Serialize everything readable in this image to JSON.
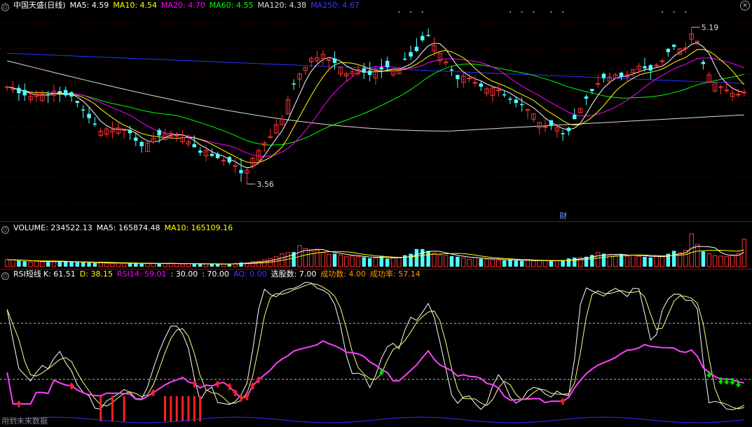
{
  "price_header": {
    "title": "中国天盛(日线)",
    "ma5": "MA5: 4.59",
    "ma10": "MA10: 4.54",
    "ma20": "MA20: 4.70",
    "ma60": "MA60: 4.55",
    "ma120": "MA120: 4.38",
    "ma250": "MA250: 4.67"
  },
  "price_annotations": {
    "high": "5.19",
    "low": "3.56",
    "event_marker": "财"
  },
  "volume_header": {
    "volume": "VOLUME: 234522.13",
    "ma5": "MA5: 165874.48",
    "ma10": "MA10: 165109.16"
  },
  "rsi_header": {
    "title": "RSI短线",
    "k": "K: 61.51",
    "d": "D: 38.15",
    "rsi14": "RSI14: 59.01",
    "low": ": 30.00",
    "high": ": 70.00",
    "aq": "AQ: 0.00",
    "selected": "选股数: 7.00",
    "success": "成功数: 4.00",
    "rate": "成功率: 57.14"
  },
  "footer": {
    "note": "用到未来数据"
  },
  "colors": {
    "ma5": "#ffffff",
    "ma10": "#ffff00",
    "ma20": "#ff00ff",
    "ma60": "#00ff00",
    "ma120": "#dcdcdc",
    "ma250": "#3030ff",
    "up": "#ff3232",
    "down": "#54ffff",
    "separator": "#a00000",
    "k_line": "#ffffff",
    "d_line": "#ffff80",
    "rsi_line": "#ff40ff",
    "buy_signal": "#ff2020",
    "sell_signal": "#00e000"
  },
  "chart_data": [
    {
      "type": "candlestick",
      "title": "中国天盛(日线)",
      "ylim": [
        3.5,
        5.3
      ],
      "high_label": 5.19,
      "low_label": 3.56,
      "series": [
        {
          "name": "MA5",
          "value": 4.59
        },
        {
          "name": "MA10",
          "value": 4.54
        },
        {
          "name": "MA20",
          "value": 4.7
        },
        {
          "name": "MA60",
          "value": 4.55
        },
        {
          "name": "MA120",
          "value": 4.38
        },
        {
          "name": "MA250",
          "value": 4.67
        }
      ],
      "close": [
        4.64,
        4.62,
        4.58,
        4.56,
        4.55,
        4.57,
        4.57,
        4.56,
        4.6,
        4.58,
        4.56,
        4.55,
        4.49,
        4.42,
        4.35,
        4.29,
        4.23,
        4.25,
        4.24,
        4.26,
        4.24,
        4.21,
        4.14,
        4.09,
        4.12,
        4.16,
        4.19,
        4.21,
        4.21,
        4.19,
        4.17,
        4.13,
        4.08,
        4.03,
        4.05,
        4.0,
        3.98,
        3.96,
        3.94,
        3.91,
        3.84,
        3.87,
        3.98,
        4.05,
        4.12,
        4.18,
        4.29,
        4.34,
        4.52,
        4.66,
        4.76,
        4.82,
        4.9,
        4.91,
        4.94,
        4.89,
        4.86,
        4.82,
        4.76,
        4.78,
        4.8,
        4.77,
        4.75,
        4.8,
        4.8,
        4.82,
        4.79,
        4.8,
        4.89,
        4.92,
        4.97,
        5.07,
        5.11,
        5.02,
        4.95,
        4.87,
        4.79,
        4.71,
        4.74,
        4.72,
        4.68,
        4.64,
        4.62,
        4.63,
        4.61,
        4.56,
        4.52,
        4.49,
        4.47,
        4.43,
        4.39,
        4.31,
        4.27,
        4.28,
        4.26,
        4.2,
        4.23,
        4.34,
        4.44,
        4.53,
        4.6,
        4.67,
        4.72,
        4.73,
        4.75,
        4.73,
        4.75,
        4.8,
        4.83,
        4.81,
        4.79,
        4.84,
        4.88,
        4.96,
        5.01,
        4.99,
        5.0,
        5.13,
        5.06,
        4.85,
        4.75,
        4.68,
        4.64,
        4.61,
        4.58,
        4.57,
        4.59
      ],
      "open": [
        4.64,
        4.62,
        4.63,
        4.61,
        4.52,
        4.55,
        4.51,
        4.57,
        4.56,
        4.6,
        4.61,
        4.59,
        4.51,
        4.43,
        4.39,
        4.3,
        4.19,
        4.2,
        4.22,
        4.21,
        4.24,
        4.24,
        4.17,
        4.13,
        4.04,
        4.13,
        4.24,
        4.15,
        4.18,
        4.19,
        4.13,
        4.11,
        4.11,
        4.05,
        4.0,
        4.02,
        4.02,
        3.96,
        3.99,
        3.91,
        3.87,
        3.84,
        3.91,
        3.96,
        4.1,
        4.17,
        4.21,
        4.29,
        4.39,
        4.67,
        4.71,
        4.79,
        4.87,
        4.88,
        4.9,
        4.89,
        4.9,
        4.76,
        4.74,
        4.76,
        4.76,
        4.81,
        4.79,
        4.72,
        4.82,
        4.88,
        4.75,
        4.76,
        4.9,
        4.96,
        5.01,
        5.11,
        5.12,
        4.97,
        4.88,
        4.86,
        4.8,
        4.75,
        4.68,
        4.72,
        4.68,
        4.67,
        4.58,
        4.56,
        4.61,
        4.57,
        4.53,
        4.52,
        4.48,
        4.42,
        4.34,
        4.26,
        4.27,
        4.33,
        4.23,
        4.21,
        4.26,
        4.38,
        4.4,
        4.55,
        4.62,
        4.67,
        4.76,
        4.69,
        4.72,
        4.77,
        4.73,
        4.77,
        4.8,
        4.83,
        4.84,
        4.84,
        4.88,
        4.99,
        5.03,
        4.94,
        5.0,
        5.08,
        5.05,
        4.87,
        4.68,
        4.6,
        4.64,
        4.61,
        4.55,
        4.57,
        4.59
      ],
      "high": [
        4.65,
        4.69,
        4.66,
        4.67,
        4.6,
        4.61,
        4.61,
        4.6,
        4.66,
        4.64,
        4.64,
        4.6,
        4.51,
        4.47,
        4.45,
        4.36,
        4.26,
        4.27,
        4.32,
        4.31,
        4.25,
        4.28,
        4.22,
        4.14,
        4.14,
        4.22,
        4.26,
        4.25,
        4.24,
        4.22,
        4.24,
        4.2,
        4.19,
        4.08,
        4.1,
        4.07,
        4.04,
        4.01,
        4.0,
        3.98,
        3.98,
        3.88,
        3.99,
        4.07,
        4.14,
        4.25,
        4.34,
        4.38,
        4.56,
        4.71,
        4.77,
        4.82,
        4.92,
        4.97,
        4.98,
        4.89,
        4.97,
        4.82,
        4.78,
        4.81,
        4.84,
        4.86,
        4.87,
        4.82,
        4.9,
        4.92,
        4.8,
        4.82,
        4.96,
        5.02,
        5.09,
        5.15,
        5.18,
        5.1,
        4.95,
        4.89,
        4.83,
        4.75,
        4.78,
        4.76,
        4.74,
        4.69,
        4.64,
        4.65,
        4.66,
        4.61,
        4.55,
        4.55,
        4.54,
        4.44,
        4.39,
        4.31,
        4.35,
        4.33,
        4.3,
        4.24,
        4.27,
        4.44,
        4.44,
        4.57,
        4.62,
        4.75,
        4.77,
        4.77,
        4.77,
        4.78,
        4.79,
        4.8,
        4.86,
        4.91,
        4.85,
        4.86,
        4.9,
        5.0,
        5.03,
        5.0,
        5.05,
        5.19,
        5.07,
        4.89,
        4.78,
        4.68,
        4.66,
        4.69,
        4.63,
        4.62,
        4.62
      ],
      "low": [
        4.6,
        4.58,
        4.51,
        4.51,
        4.49,
        4.5,
        4.5,
        4.49,
        4.5,
        4.5,
        4.54,
        4.5,
        4.45,
        4.35,
        4.3,
        4.27,
        4.17,
        4.17,
        4.16,
        4.19,
        4.16,
        4.15,
        4.09,
        4.03,
        4.04,
        4.11,
        4.12,
        4.15,
        4.17,
        4.13,
        4.11,
        4.08,
        4.08,
        4.0,
        3.95,
        3.99,
        3.97,
        3.91,
        3.92,
        3.84,
        3.76,
        3.74,
        3.88,
        3.92,
        4.04,
        4.16,
        4.21,
        4.29,
        4.38,
        4.61,
        4.63,
        4.75,
        4.82,
        4.84,
        4.84,
        4.78,
        4.8,
        4.73,
        4.69,
        4.73,
        4.74,
        4.71,
        4.69,
        4.66,
        4.72,
        4.79,
        4.73,
        4.76,
        4.88,
        4.89,
        4.96,
        5.05,
        5.1,
        4.92,
        4.84,
        4.83,
        4.74,
        4.63,
        4.63,
        4.68,
        4.64,
        4.6,
        4.55,
        4.5,
        4.55,
        4.54,
        4.48,
        4.45,
        4.41,
        4.34,
        4.31,
        4.2,
        4.22,
        4.24,
        4.17,
        4.14,
        4.19,
        4.35,
        4.39,
        4.47,
        4.57,
        4.63,
        4.68,
        4.66,
        4.71,
        4.7,
        4.68,
        4.73,
        4.76,
        4.78,
        4.71,
        4.82,
        4.82,
        4.92,
        4.98,
        4.93,
        4.95,
        5.04,
        5.02,
        4.8,
        4.68,
        4.59,
        4.57,
        4.58,
        4.51,
        4.54,
        4.55
      ]
    },
    {
      "type": "bar",
      "title": "VOLUME",
      "series": [
        {
          "name": "VOLUME",
          "value": 234522.13
        },
        {
          "name": "MA5",
          "value": 165874.48
        },
        {
          "name": "MA10",
          "value": 165109.16
        }
      ],
      "values": [
        60000,
        58000,
        52000,
        47000,
        40000,
        47000,
        41000,
        46000,
        42000,
        41000,
        44000,
        39000,
        37000,
        36000,
        34000,
        30000,
        34000,
        31000,
        30000,
        31000,
        29000,
        28000,
        26000,
        25000,
        30000,
        28000,
        26000,
        27000,
        29000,
        26000,
        23000,
        26000,
        23000,
        25000,
        23000,
        23000,
        20000,
        22000,
        27000,
        29000,
        36000,
        33000,
        45000,
        47000,
        60000,
        70000,
        85000,
        110000,
        120000,
        125000,
        180000,
        155000,
        135000,
        140000,
        120000,
        105000,
        110000,
        100000,
        85000,
        90000,
        85000,
        81000,
        72000,
        75000,
        90000,
        68000,
        74000,
        76000,
        98000,
        110000,
        150000,
        150000,
        135000,
        115000,
        100000,
        96000,
        90000,
        85000,
        76000,
        64000,
        80000,
        68000,
        64000,
        60000,
        56000,
        54000,
        62000,
        52000,
        50000,
        55000,
        49000,
        54000,
        52000,
        50000,
        49000,
        55000,
        70000,
        78000,
        79000,
        85000,
        100000,
        120000,
        110000,
        98000,
        96000,
        105000,
        90000,
        100000,
        88000,
        84000,
        78000,
        92000,
        86000,
        110000,
        135000,
        120000,
        140000,
        280000,
        190000,
        130000,
        110000,
        95000,
        90000,
        85000,
        100000,
        110000,
        234522
      ]
    },
    {
      "type": "line",
      "title": "RSI短线",
      "ylim": [
        0,
        100
      ],
      "reference_lines": [
        30,
        70
      ],
      "series": [
        {
          "name": "K",
          "value": 61.51
        },
        {
          "name": "D",
          "value": 38.15
        },
        {
          "name": "RSI14",
          "value": 59.01
        },
        {
          "name": "AQ",
          "value": 0.0
        }
      ],
      "stats": {
        "选股数": 7.0,
        "成功数": 4.0,
        "成功率": 57.14
      },
      "buy_signal_bars": [
        16,
        18,
        20,
        27,
        28,
        29,
        30,
        31,
        32,
        33
      ],
      "sell_signal_bars": []
    }
  ]
}
